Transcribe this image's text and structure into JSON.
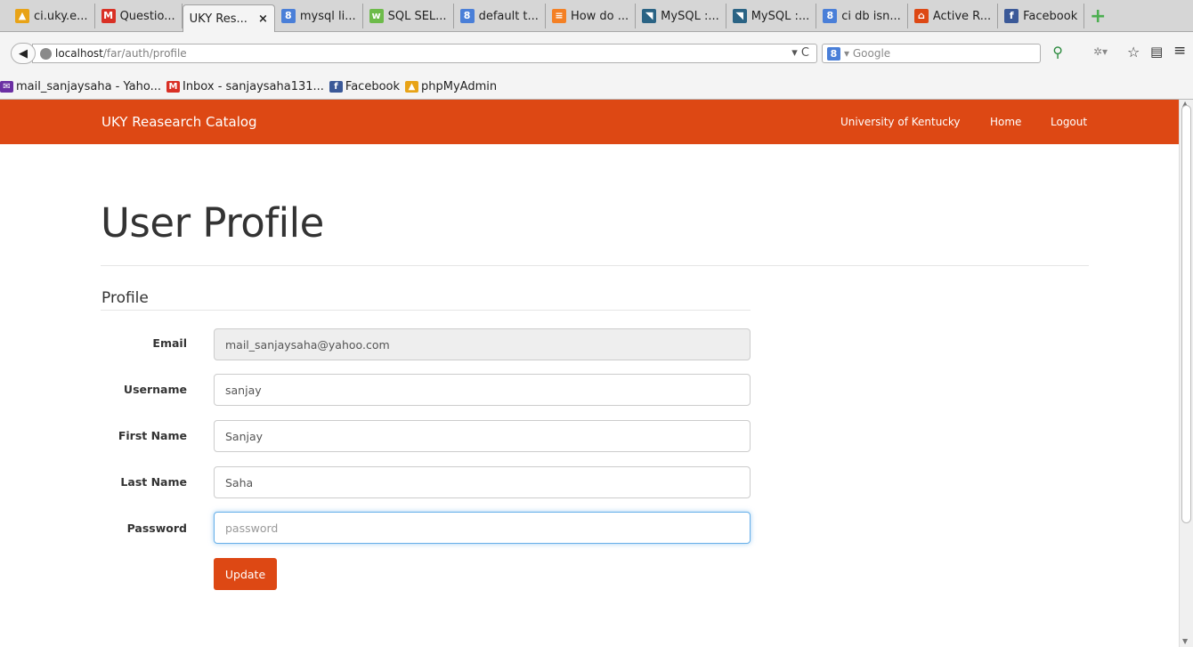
{
  "browser": {
    "tabs": [
      {
        "label": "ci.uky.e...",
        "icon": "phpmyadmin-icon",
        "color": "#e8a317",
        "glyph": "▲"
      },
      {
        "label": "Questio...",
        "icon": "gmail-icon",
        "color": "#d93025",
        "glyph": "M"
      },
      {
        "label": "UKY Res...",
        "icon": "",
        "color": "",
        "glyph": "",
        "active": true
      },
      {
        "label": "mysql li...",
        "icon": "google-icon",
        "color": "#4a7fd8",
        "glyph": "8"
      },
      {
        "label": "SQL SEL...",
        "icon": "w3schools-icon",
        "color": "#6dbb4a",
        "glyph": "w"
      },
      {
        "label": "default t...",
        "icon": "google-icon",
        "color": "#4a7fd8",
        "glyph": "8"
      },
      {
        "label": "How do ...",
        "icon": "stackoverflow-icon",
        "color": "#f48024",
        "glyph": "≡"
      },
      {
        "label": "MySQL :...",
        "icon": "mysql-icon",
        "color": "#2a6384",
        "glyph": "◥"
      },
      {
        "label": "MySQL :...",
        "icon": "mysql-icon",
        "color": "#2a6384",
        "glyph": "◥"
      },
      {
        "label": "ci db isn...",
        "icon": "google-icon",
        "color": "#4a7fd8",
        "glyph": "8"
      },
      {
        "label": "Active R...",
        "icon": "codeigniter-icon",
        "color": "#dd4814",
        "glyph": "⌂"
      },
      {
        "label": "Facebook",
        "icon": "facebook-icon",
        "color": "#3b5998",
        "glyph": "f"
      }
    ],
    "close_glyph": "×",
    "new_tab_glyph": "+",
    "url_host": "localhost",
    "url_path": "/far/auth/profile",
    "url_right": "▾ C",
    "search_placeholder": "▾ Google",
    "search_g": "8",
    "bookmarks": [
      {
        "label": "mail_sanjaysaha - Yaho...",
        "icon": "mail-icon",
        "color": "#6b2fa3",
        "glyph": "✉"
      },
      {
        "label": "Inbox - sanjaysaha131...",
        "icon": "gmail-icon",
        "color": "#d93025",
        "glyph": "M"
      },
      {
        "label": "Facebook",
        "icon": "facebook-icon",
        "color": "#3b5998",
        "glyph": "f"
      },
      {
        "label": "phpMyAdmin",
        "icon": "phpmyadmin-icon",
        "color": "#e8a317",
        "glyph": "▲"
      }
    ]
  },
  "header": {
    "brand": "UKY Reasearch Catalog",
    "nav": [
      "University of Kentucky",
      "Home",
      "Logout"
    ],
    "color": "#dd4814"
  },
  "page": {
    "title": "User Profile",
    "section": "Profile"
  },
  "form": {
    "email_label": "Email",
    "email_value": "mail_sanjaysaha@yahoo.com",
    "username_label": "Username",
    "username_value": "sanjay",
    "first_name_label": "First Name",
    "first_name_value": "Sanjay",
    "last_name_label": "Last Name",
    "last_name_value": "Saha",
    "password_label": "Password",
    "password_placeholder": "password",
    "update_label": "Update"
  }
}
